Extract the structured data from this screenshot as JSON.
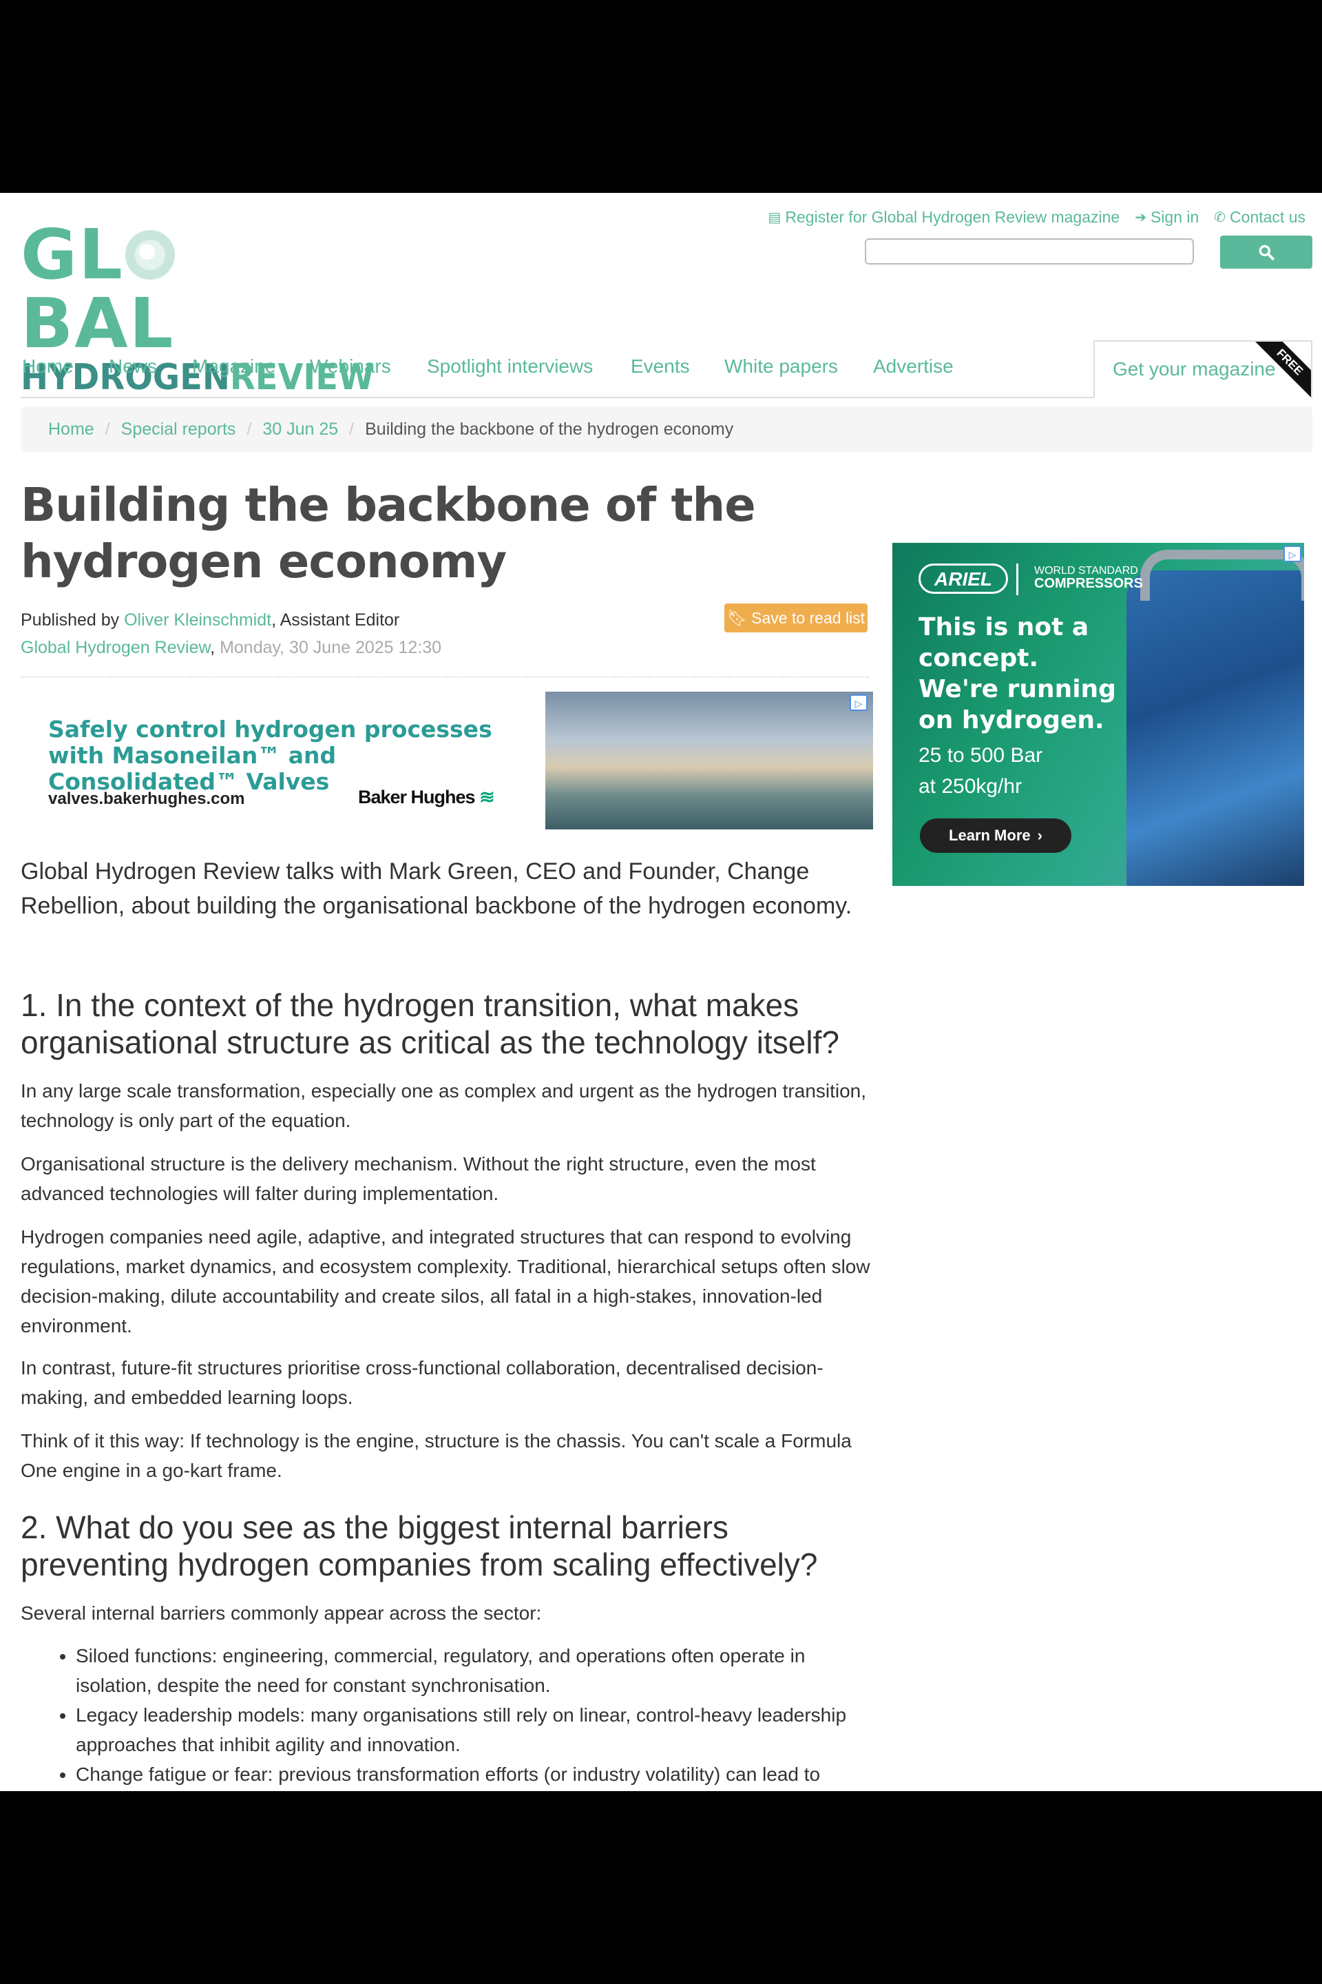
{
  "header": {
    "logo_top": "GL",
    "logo_top_rest": "BAL",
    "logo_hydrogen": "HYDROGEN",
    "logo_review": "REVIEW",
    "register_link": "Register for Global Hydrogen Review magazine",
    "signin_link": "Sign in",
    "contact_link": "Contact us",
    "search_placeholder": ""
  },
  "nav": {
    "items": [
      "Home",
      "News",
      "Magazine",
      "Webinars",
      "Spotlight interviews",
      "Events",
      "White papers",
      "Advertise"
    ],
    "magazine_tab": "Get your magazine",
    "ribbon": "FREE"
  },
  "breadcrumb": {
    "items": [
      "Home",
      "Special reports",
      "30 Jun 25"
    ],
    "current": "Building the backbone of the hydrogen economy",
    "separator": "/"
  },
  "article": {
    "title": "Building the backbone of the hydrogen economy",
    "published_by_prefix": "Published by",
    "author": "Oliver Kleinschmidt",
    "author_role": ", Assistant Editor",
    "publication": "Global Hydrogen Review",
    "date": "Monday, 30 June 2025 12:30",
    "save_button": "Save to read list",
    "intro": "Global Hydrogen Review talks with Mark Green, CEO and Founder, Change Rebellion, about building the organisational backbone of the hydrogen economy.",
    "q1": "1. In the context of the hydrogen transition, what makes organisational structure as critical as the technology itself?",
    "q1_paragraphs": [
      "In any large scale transformation, especially one as complex and urgent as the hydrogen transition, technology is only part of the equation.",
      "Organisational structure is the delivery mechanism. Without the right structure, even the most advanced technologies will falter during implementation.",
      "Hydrogen companies need agile, adaptive, and integrated structures that can respond to evolving regulations, market dynamics, and ecosystem complexity. Traditional, hierarchical setups often slow decision-making, dilute accountability and create silos, all fatal in a high-stakes, innovation-led environment.",
      "In contrast, future-fit structures prioritise cross-functional collaboration, decentralised decision-making, and embedded learning loops.",
      "Think of it this way: If technology is the engine, structure is the chassis. You can't scale a Formula One engine in a go-kart frame."
    ],
    "q2": "2. What do you see as the biggest internal barriers preventing hydrogen companies from scaling effectively?",
    "q2_lead": "Several internal barriers commonly appear across the sector:",
    "q2_bullets": [
      "Siloed functions: engineering, commercial, regulatory, and operations often operate in isolation, despite the need for constant synchronisation.",
      "Legacy leadership models: many organisations still rely on linear, control-heavy leadership approaches that inhibit agility and innovation.",
      "Change fatigue or fear: previous transformation efforts (or industry volatility) can lead to"
    ]
  },
  "banner_ad": {
    "headline": "Safely control hydrogen processes with Masoneilan™ and Consolidated™ Valves",
    "url": "valves.bakerhughes.com",
    "brand": "Baker Hughes",
    "adchoice": "▷"
  },
  "side_ad": {
    "brand": "ARIEL",
    "tag_small": "WORLD STANDARD",
    "tag_big": "COMPRESSORS",
    "headline": "This is not a concept. We're running on hydrogen.",
    "sub1": "25 to 500 Bar",
    "sub2": "at 250kg/hr",
    "cta": "Learn More",
    "adchoice": "▷"
  },
  "colors": {
    "accent": "#5ab99a",
    "logo_dark": "#3b8f87",
    "save_button": "#f0ad4e"
  }
}
